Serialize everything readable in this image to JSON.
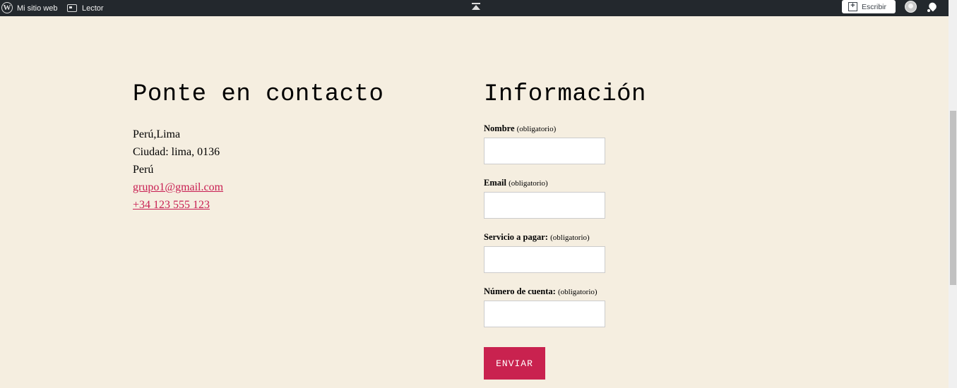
{
  "adminbar": {
    "wp_logo_icon": "wordpress-icon",
    "site_name": "Mi sitio web",
    "reader_label": "Lector",
    "write_label": "Escribir",
    "avatar_icon": "user-avatar",
    "notifications_icon": "bell-icon"
  },
  "contact": {
    "heading": "Ponte en contacto",
    "lines": [
      "Perú,Lima",
      "Ciudad: lima, 0136",
      "Perú"
    ],
    "email": "grupo1@gmail.com",
    "phone": "+34 123 555 123"
  },
  "info": {
    "heading": "Información",
    "fields": [
      {
        "label": "Nombre",
        "required": "(obligatorio)",
        "value": ""
      },
      {
        "label": "Email",
        "required": "(obligatorio)",
        "value": ""
      },
      {
        "label": "Servicio a pagar:",
        "required": "(obligatorio)",
        "value": ""
      },
      {
        "label": "Número de cuenta:",
        "required": "(obligatorio)",
        "value": ""
      }
    ],
    "submit_label": "ENVIAR"
  },
  "colors": {
    "background": "#f5eee0",
    "accent": "#c9224f",
    "adminbar": "#23282d"
  }
}
